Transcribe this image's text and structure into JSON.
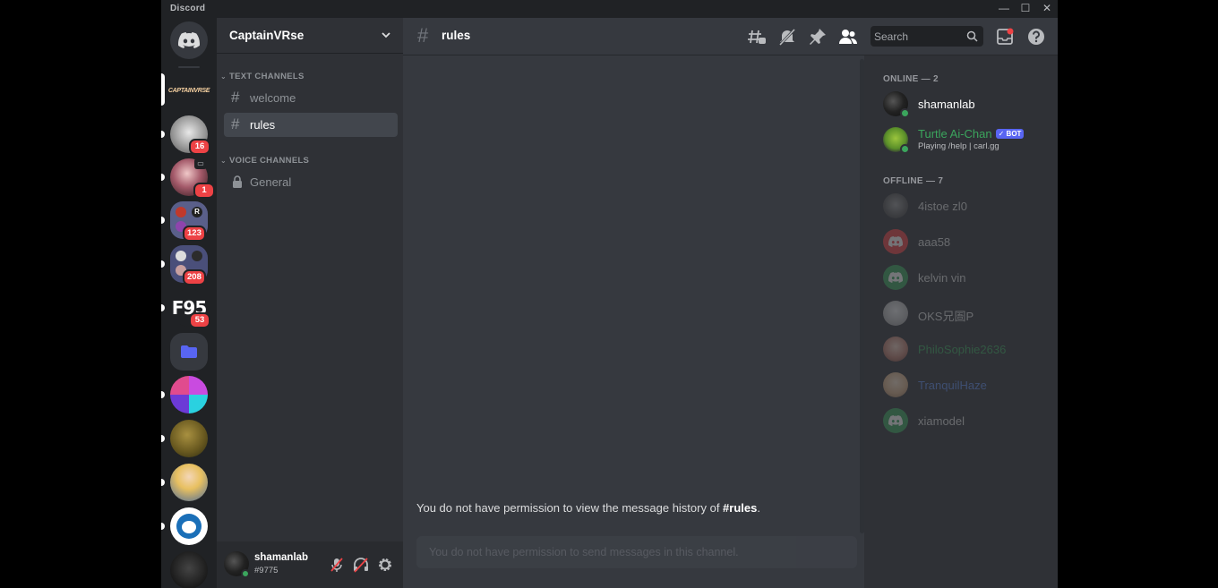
{
  "window": {
    "app_name": "Discord",
    "minimize": "—",
    "maximize": "☐",
    "close": "✕"
  },
  "server_rail": {
    "badges": [
      "16",
      "1",
      "123",
      "208",
      "53"
    ],
    "f95_label": "F95",
    "captain_label": "CAPTAINVRSE"
  },
  "guild": {
    "name": "CaptainVRse",
    "categories": {
      "text": "TEXT CHANNELS",
      "voice": "VOICE CHANNELS"
    },
    "channels": {
      "welcome": "welcome",
      "rules": "rules",
      "general": "General"
    }
  },
  "user_panel": {
    "username": "shamanlab",
    "tag": "#9775"
  },
  "header": {
    "channel": "rules",
    "search_placeholder": "Search"
  },
  "chat": {
    "no_history_prefix": "You do not have permission to view the message history of ",
    "no_history_channel": "#rules",
    "no_history_suffix": ".",
    "composer_placeholder": "You do not have permission to send messages in this channel."
  },
  "members": {
    "online_header": "ONLINE — 2",
    "offline_header": "OFFLINE — 7",
    "online": [
      {
        "name": "shamanlab"
      },
      {
        "name": "Turtle Ai-Chan",
        "bot_tag": "✓ BOT",
        "activity": "Playing /help | carl.gg",
        "color": "#3ba55d"
      }
    ],
    "offline": [
      {
        "name": "4istoe zl0"
      },
      {
        "name": "aaa58",
        "avatar_color": "#ed4245"
      },
      {
        "name": "kelvin vin",
        "avatar_color": "#3ba55d"
      },
      {
        "name": "OKS兄圄P"
      },
      {
        "name": "PhiloSophie2636",
        "color": "#3ba55d"
      },
      {
        "name": "TranquilHaze",
        "color": "#5d8be8"
      },
      {
        "name": "xiamodel",
        "avatar_color": "#3ba55d"
      }
    ]
  },
  "colors": {
    "blurple": "#5865f2",
    "online_green": "#3ba55d",
    "mention_red": "#ed4245"
  }
}
